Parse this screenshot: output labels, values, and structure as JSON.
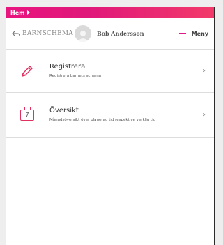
{
  "breadcrumb": {
    "home_label": "Hem"
  },
  "header": {
    "app_title": "BARNSCHEMA",
    "user_name": "Bob Andersson",
    "menu_label": "Meny"
  },
  "list": {
    "items": [
      {
        "title": "Registrera",
        "subtitle": "Registrera barnets schema"
      },
      {
        "title": "Översikt",
        "subtitle": "Månadsöversikt över planerad tid respektive verklig tid",
        "icon_text": "7"
      }
    ]
  },
  "colors": {
    "brand_pink": "#e8157f",
    "accent_red": "#e03060"
  }
}
